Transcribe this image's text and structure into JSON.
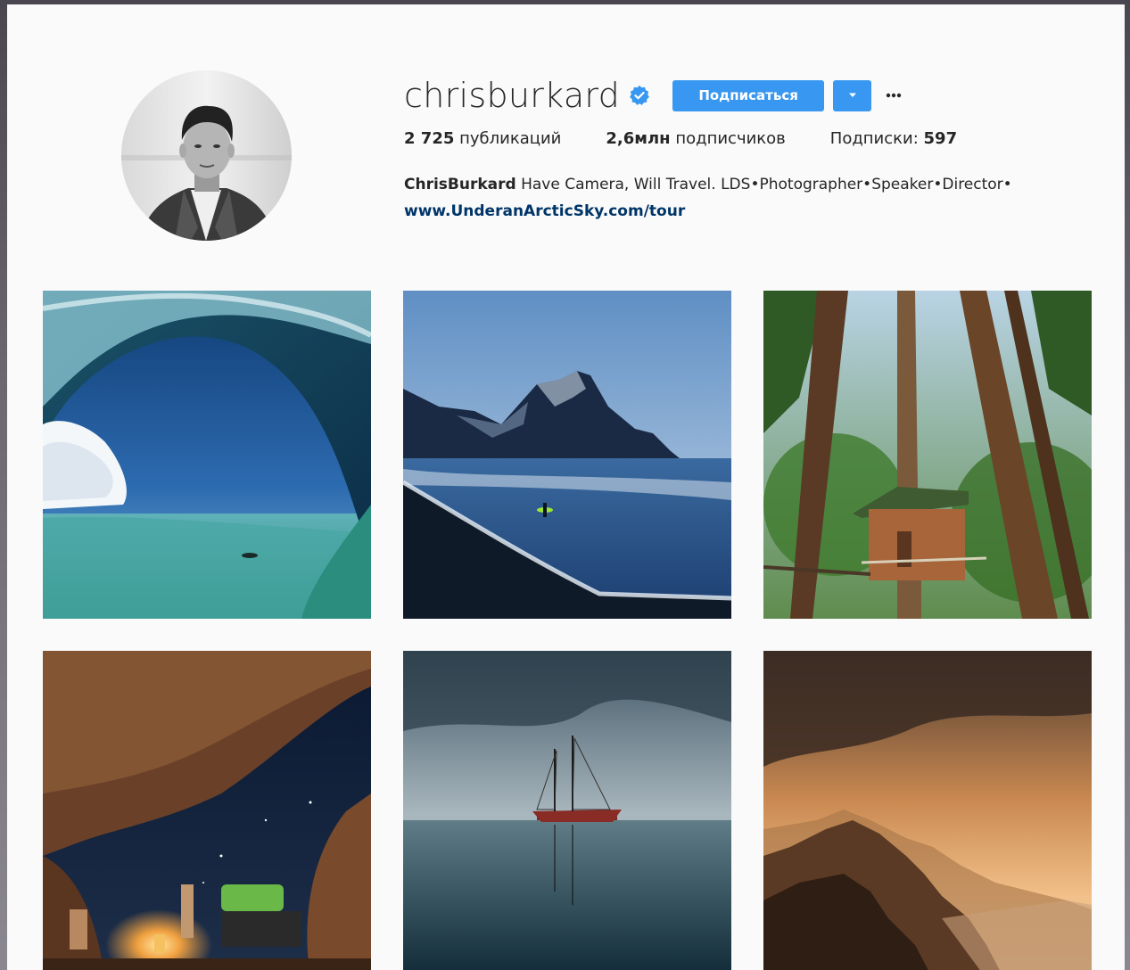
{
  "profile": {
    "username": "chrisburkard",
    "follow_label": "Подписаться",
    "stats": {
      "posts_count": "2 725",
      "posts_label": "публикаций",
      "followers_count": "2,6млн",
      "followers_label": "подписчиков",
      "following_label": "Подписки:",
      "following_count": "597"
    },
    "bio": {
      "name": "ChrisBurkard",
      "text": "Have Camera, Will Travel. LDS•Photographer•Speaker•Director•",
      "link": "www.UnderanArcticSky.com/tour"
    },
    "avatar_icon": "avatar-photo",
    "verified_icon": "verified-badge-icon"
  },
  "colors": {
    "accent": "#3897f0",
    "link": "#003569",
    "text": "#262626",
    "background": "#fafafa"
  },
  "posts": [
    {
      "subject": "ocean-wave-barrel"
    },
    {
      "subject": "black-sand-beach-mountain-surfer"
    },
    {
      "subject": "treehouse-in-forest"
    },
    {
      "subject": "campfire-under-rock-arch"
    },
    {
      "subject": "sailboat-in-fog"
    },
    {
      "subject": "sunset-coastal-cliffs"
    }
  ]
}
